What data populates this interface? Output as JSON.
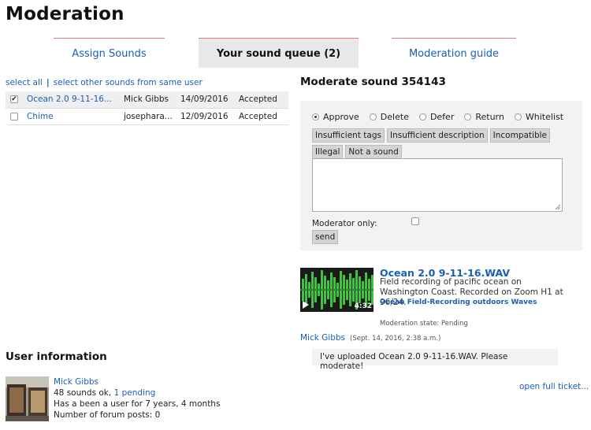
{
  "page": {
    "title": "Moderation"
  },
  "tabs": [
    {
      "label": "Assign Sounds"
    },
    {
      "label": "Your sound queue (2)"
    },
    {
      "label": "Moderation guide"
    }
  ],
  "selection": {
    "select_all": "select all",
    "separator": "|",
    "select_same_user": "select other sounds from same user"
  },
  "queue": [
    {
      "checked": true,
      "sound": "Ocean 2.0 9-11-16...",
      "user": "Mick Gibbs",
      "date": "14/09/2016",
      "status": "Accepted"
    },
    {
      "checked": false,
      "sound": "Chime",
      "user": "josephara...",
      "date": "12/09/2016",
      "status": "Accepted"
    }
  ],
  "moderate": {
    "heading": "Moderate sound 354143",
    "options": [
      {
        "label": "Approve",
        "selected": true
      },
      {
        "label": "Delete",
        "selected": false
      },
      {
        "label": "Defer",
        "selected": false
      },
      {
        "label": "Return",
        "selected": false
      },
      {
        "label": "Whitelist",
        "selected": false
      }
    ],
    "templates": [
      "Insufficient tags",
      "Insufficient description",
      "Incompatible",
      "Illegal",
      "Not a sound"
    ],
    "message": "",
    "moderator_only_label": "Moderator only:",
    "send_label": "send"
  },
  "sound": {
    "title": "Ocean 2.0 9-11-16.WAV",
    "description": "Field recording of pacific ocean on Washington Coast. Recorded on Zoom H1 at 96/24.",
    "tags": [
      "Ocean",
      "Field-Recording",
      "outdoors",
      "Waves"
    ],
    "duration": "4:32",
    "moderation_state": "Moderation state: Pending"
  },
  "comment": {
    "author": "Mick Gibbs",
    "date": "(Sept. 14, 2016, 2:38 a.m.)",
    "text": "I've uploaded Ocean 2.0 9-11-16.WAV. Please moderate!"
  },
  "user_info": {
    "heading": "User information",
    "name": "Mick Gibbs",
    "sounds_ok": "48 sounds ok,",
    "pending": "1 pending",
    "member_for": "Has a been a user for 7 years, 4 months",
    "forum_posts": "Number of forum posts: 0",
    "open_ticket": "open full ticket..."
  },
  "colors": {
    "link": "#1a5fb4",
    "tab_border": "#e07a7a",
    "waveform_green": "#3ec43e",
    "panel_bg": "#f2f2f2"
  }
}
